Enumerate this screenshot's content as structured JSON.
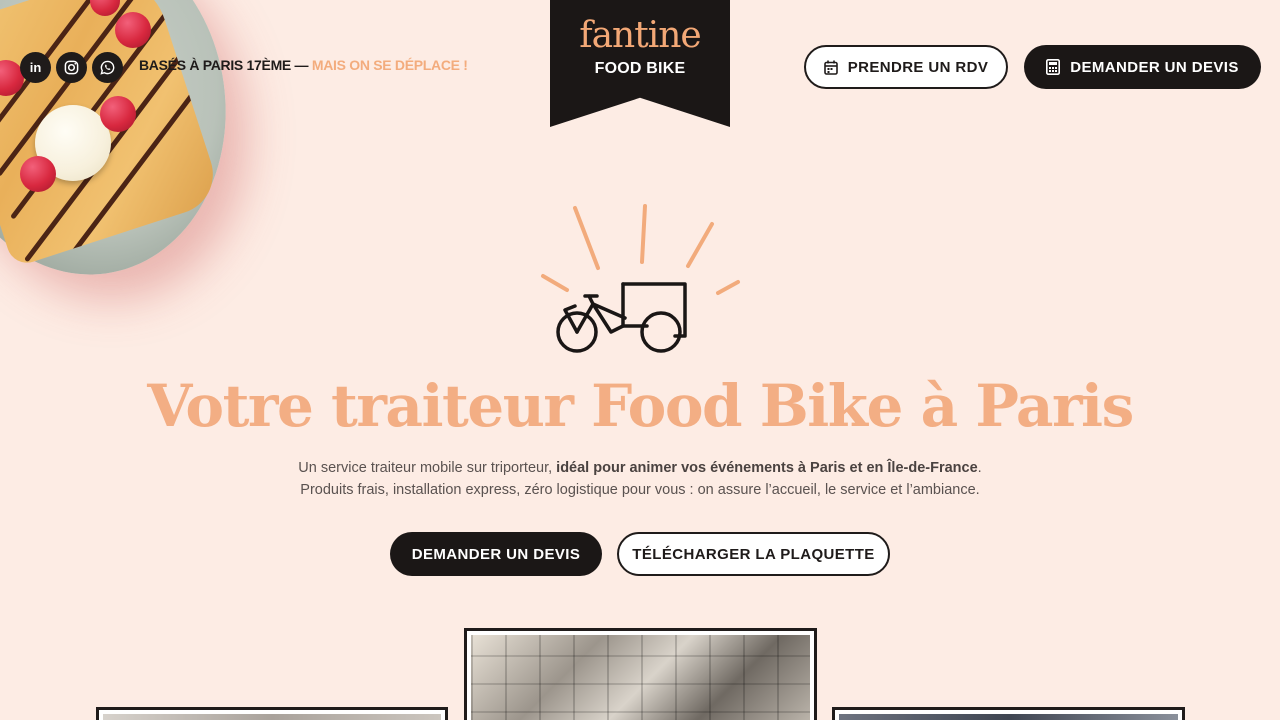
{
  "header": {
    "social": [
      {
        "name": "linkedin-icon",
        "glyph": "in"
      },
      {
        "name": "instagram-icon",
        "glyph": "◎"
      },
      {
        "name": "whatsapp-icon",
        "glyph": "✆"
      }
    ],
    "based_text": "BASÉS À PARIS 17ÈME — ",
    "based_accent": "MAIS ON SE DÉPLACE !",
    "logo_name": "fantine",
    "logo_sub": "FOOD BIKE",
    "rdv_label": "PRENDRE UN RDV",
    "devis_label": "DEMANDER UN DEVIS"
  },
  "hero": {
    "title": "Votre traiteur Food Bike à Paris",
    "line1_plain": "Un service traiteur mobile sur triporteur, ",
    "line1_bold": "idéal pour animer vos événements à Paris et en Île-de-France",
    "line1_end": ".",
    "line2": "Produits frais, installation express, zéro logistique pour vous : on assure l’accueil, le service et l’ambiance.",
    "cta_primary": "DEMANDER UN DEVIS",
    "cta_secondary": "TÉLÉCHARGER LA PLAQUETTE"
  },
  "colors": {
    "background": "#fdece4",
    "accent": "#f3ae84",
    "dark": "#1b1716"
  }
}
